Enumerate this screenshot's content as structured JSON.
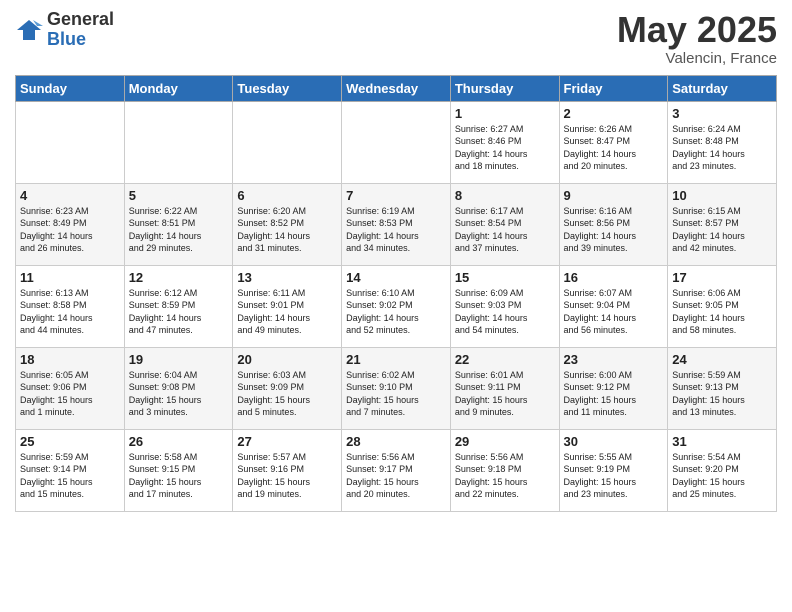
{
  "logo": {
    "general": "General",
    "blue": "Blue"
  },
  "header": {
    "month": "May 2025",
    "location": "Valencin, France"
  },
  "weekdays": [
    "Sunday",
    "Monday",
    "Tuesday",
    "Wednesday",
    "Thursday",
    "Friday",
    "Saturday"
  ],
  "weeks": [
    [
      {
        "day": "",
        "info": ""
      },
      {
        "day": "",
        "info": ""
      },
      {
        "day": "",
        "info": ""
      },
      {
        "day": "",
        "info": ""
      },
      {
        "day": "1",
        "info": "Sunrise: 6:27 AM\nSunset: 8:46 PM\nDaylight: 14 hours\nand 18 minutes."
      },
      {
        "day": "2",
        "info": "Sunrise: 6:26 AM\nSunset: 8:47 PM\nDaylight: 14 hours\nand 20 minutes."
      },
      {
        "day": "3",
        "info": "Sunrise: 6:24 AM\nSunset: 8:48 PM\nDaylight: 14 hours\nand 23 minutes."
      }
    ],
    [
      {
        "day": "4",
        "info": "Sunrise: 6:23 AM\nSunset: 8:49 PM\nDaylight: 14 hours\nand 26 minutes."
      },
      {
        "day": "5",
        "info": "Sunrise: 6:22 AM\nSunset: 8:51 PM\nDaylight: 14 hours\nand 29 minutes."
      },
      {
        "day": "6",
        "info": "Sunrise: 6:20 AM\nSunset: 8:52 PM\nDaylight: 14 hours\nand 31 minutes."
      },
      {
        "day": "7",
        "info": "Sunrise: 6:19 AM\nSunset: 8:53 PM\nDaylight: 14 hours\nand 34 minutes."
      },
      {
        "day": "8",
        "info": "Sunrise: 6:17 AM\nSunset: 8:54 PM\nDaylight: 14 hours\nand 37 minutes."
      },
      {
        "day": "9",
        "info": "Sunrise: 6:16 AM\nSunset: 8:56 PM\nDaylight: 14 hours\nand 39 minutes."
      },
      {
        "day": "10",
        "info": "Sunrise: 6:15 AM\nSunset: 8:57 PM\nDaylight: 14 hours\nand 42 minutes."
      }
    ],
    [
      {
        "day": "11",
        "info": "Sunrise: 6:13 AM\nSunset: 8:58 PM\nDaylight: 14 hours\nand 44 minutes."
      },
      {
        "day": "12",
        "info": "Sunrise: 6:12 AM\nSunset: 8:59 PM\nDaylight: 14 hours\nand 47 minutes."
      },
      {
        "day": "13",
        "info": "Sunrise: 6:11 AM\nSunset: 9:01 PM\nDaylight: 14 hours\nand 49 minutes."
      },
      {
        "day": "14",
        "info": "Sunrise: 6:10 AM\nSunset: 9:02 PM\nDaylight: 14 hours\nand 52 minutes."
      },
      {
        "day": "15",
        "info": "Sunrise: 6:09 AM\nSunset: 9:03 PM\nDaylight: 14 hours\nand 54 minutes."
      },
      {
        "day": "16",
        "info": "Sunrise: 6:07 AM\nSunset: 9:04 PM\nDaylight: 14 hours\nand 56 minutes."
      },
      {
        "day": "17",
        "info": "Sunrise: 6:06 AM\nSunset: 9:05 PM\nDaylight: 14 hours\nand 58 minutes."
      }
    ],
    [
      {
        "day": "18",
        "info": "Sunrise: 6:05 AM\nSunset: 9:06 PM\nDaylight: 15 hours\nand 1 minute."
      },
      {
        "day": "19",
        "info": "Sunrise: 6:04 AM\nSunset: 9:08 PM\nDaylight: 15 hours\nand 3 minutes."
      },
      {
        "day": "20",
        "info": "Sunrise: 6:03 AM\nSunset: 9:09 PM\nDaylight: 15 hours\nand 5 minutes."
      },
      {
        "day": "21",
        "info": "Sunrise: 6:02 AM\nSunset: 9:10 PM\nDaylight: 15 hours\nand 7 minutes."
      },
      {
        "day": "22",
        "info": "Sunrise: 6:01 AM\nSunset: 9:11 PM\nDaylight: 15 hours\nand 9 minutes."
      },
      {
        "day": "23",
        "info": "Sunrise: 6:00 AM\nSunset: 9:12 PM\nDaylight: 15 hours\nand 11 minutes."
      },
      {
        "day": "24",
        "info": "Sunrise: 5:59 AM\nSunset: 9:13 PM\nDaylight: 15 hours\nand 13 minutes."
      }
    ],
    [
      {
        "day": "25",
        "info": "Sunrise: 5:59 AM\nSunset: 9:14 PM\nDaylight: 15 hours\nand 15 minutes."
      },
      {
        "day": "26",
        "info": "Sunrise: 5:58 AM\nSunset: 9:15 PM\nDaylight: 15 hours\nand 17 minutes."
      },
      {
        "day": "27",
        "info": "Sunrise: 5:57 AM\nSunset: 9:16 PM\nDaylight: 15 hours\nand 19 minutes."
      },
      {
        "day": "28",
        "info": "Sunrise: 5:56 AM\nSunset: 9:17 PM\nDaylight: 15 hours\nand 20 minutes."
      },
      {
        "day": "29",
        "info": "Sunrise: 5:56 AM\nSunset: 9:18 PM\nDaylight: 15 hours\nand 22 minutes."
      },
      {
        "day": "30",
        "info": "Sunrise: 5:55 AM\nSunset: 9:19 PM\nDaylight: 15 hours\nand 23 minutes."
      },
      {
        "day": "31",
        "info": "Sunrise: 5:54 AM\nSunset: 9:20 PM\nDaylight: 15 hours\nand 25 minutes."
      }
    ]
  ]
}
